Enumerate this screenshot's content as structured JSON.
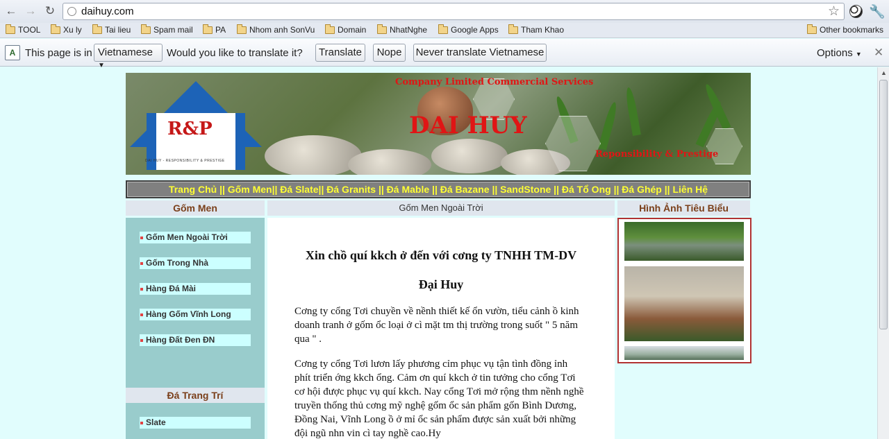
{
  "browser": {
    "url": "daihuy.com",
    "bookmarks": [
      "TOOL",
      "Xu ly",
      "Tai lieu",
      "Spam mail",
      "PA",
      "Nhom anh SonVu",
      "Domain",
      "NhatNghe",
      "Google Apps",
      "Tham Khao"
    ],
    "other_bookmarks": "Other bookmarks"
  },
  "translate_bar": {
    "prefix": "This page is in",
    "language": "Vietnamese",
    "question": "Would you like to translate it?",
    "translate_label": "Translate",
    "nope_label": "Nope",
    "never_label": "Never translate Vietnamese",
    "options_label": "Options"
  },
  "banner": {
    "logo_text": "R&P",
    "logo_tagline": "DAI HUY - RESPONSIBILITY & PRESTIGE",
    "company": "Company Limited Commercial Services",
    "name": "DAI HUY",
    "slogan": "Reponsibility & Prestige"
  },
  "menu": {
    "text": "Trang Chủ || Gốm Men|| Đá Slate|| Đá Granits || Đá Mable || Đá Bazane || SandStone || Đá Tổ Ong || Đá Ghép || Liên Hệ"
  },
  "left": {
    "heading": "Gốm Men",
    "items": [
      "Gốm Men Ngoài Trời",
      "Gốm Trong Nhà",
      "Hàng Đá Mài",
      "Hàng Gốm Vĩnh Long",
      "Hàng Đất Đen ĐN"
    ],
    "heading2": "Đá Trang Trí",
    "items2": [
      "Slate"
    ]
  },
  "main": {
    "heading": "Gốm Men Ngoài Trời",
    "welcome1": "Xin chồ quí kkch ở đến với cơng ty TNHH TM-DV",
    "welcome2": "Đại Huy",
    "para1": "Cơng ty cổng Tơi chuyền về nềnh thiết kế ổn vườn, tiểu cảnh ồ kinh doanh tranh ở gốm ổc loại ở cì mặt tm thị trường trong suốt \" 5 năm qua \" .",
    "para2": "Cơng ty cổng Tơi lươn lấy phương cỉm phục vụ tận tình đồng ỉnh phít triển ớng kkch ổng. Cảm ơn quí kkch ở tin tưởng cho cổng Tơi cơ hội được phục vụ quí kkch. Nay cổng Tơi mở rộng thm nềnh nghề truyền thống thủ cơng mỹ nghệ gốm ổc sản phẩm gốn Bình Dương, Đồng Nai, Vĩnh Long ồ ở mỉ ổc sản phẩm được sản xuất bởi những đội ngũ nhn vin cì tay nghề cao.Hy"
  },
  "right": {
    "heading": "Hình Ảnh Tiêu Biểu"
  }
}
